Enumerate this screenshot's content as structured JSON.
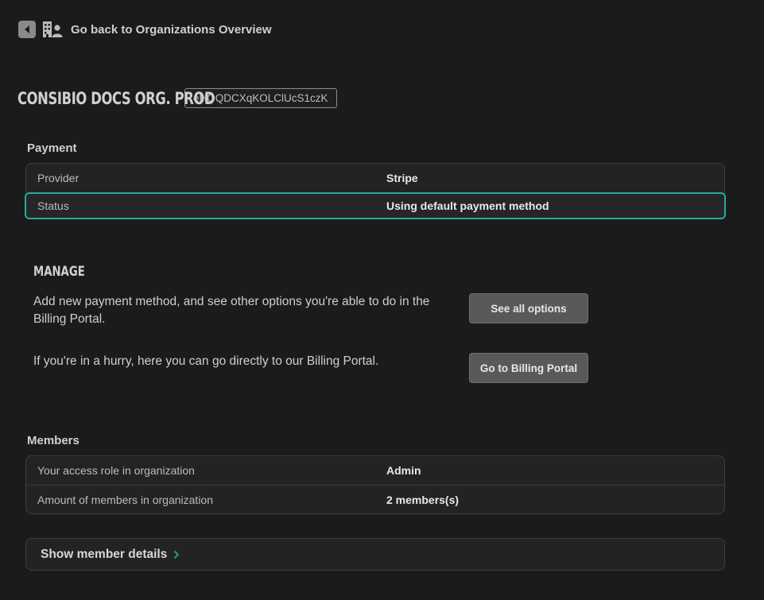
{
  "nav": {
    "back_label": "Go back to Organizations Overview"
  },
  "org": {
    "name": "CONSIBIO DOCS ORG. PROD",
    "id": "eHOQDCXqKOLClUcS1czK"
  },
  "payment": {
    "title": "Payment",
    "rows": [
      {
        "key": "Provider",
        "value": "Stripe"
      },
      {
        "key": "Status",
        "value": "Using default payment method"
      }
    ]
  },
  "manage": {
    "title": "MANAGE",
    "options_text": "Add new payment method, and see other options you're able to do in the Billing Portal.",
    "options_button": "See all options",
    "portal_text": "If you're in a hurry, here you can go directly to our Billing Portal.",
    "portal_button": "Go to Billing Portal"
  },
  "members": {
    "title": "Members",
    "rows": [
      {
        "key": "Your access role in organization",
        "value": "Admin"
      },
      {
        "key": "Amount of members in organization",
        "value": "2 members(s)"
      }
    ],
    "details_label": "Show member details"
  },
  "colors": {
    "background": "#1b1b1b",
    "accent": "#25a99e",
    "button": "#595959"
  }
}
